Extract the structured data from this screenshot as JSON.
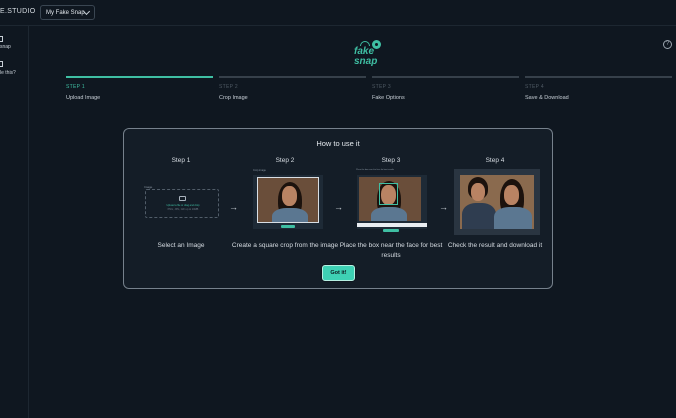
{
  "app": {
    "brand": "E.STUDIO"
  },
  "header": {
    "project_select": "My Fake Snap"
  },
  "sidebar": {
    "items": [
      {
        "label": "snap"
      },
      {
        "label": "le this?"
      }
    ]
  },
  "logo": {
    "top_word": "fake",
    "bottom_word": "snap"
  },
  "stepper": {
    "steps": [
      {
        "num": "STEP 1",
        "label": "Upload Image",
        "active": true
      },
      {
        "num": "STEP 2",
        "label": "Crop Image",
        "active": false
      },
      {
        "num": "STEP 3",
        "label": "Fake Options",
        "active": false
      },
      {
        "num": "STEP 4",
        "label": "Save & Download",
        "active": false
      }
    ]
  },
  "modal": {
    "title": "How to use it",
    "columns": [
      {
        "title": "Step 1",
        "desc": "Select an Image"
      },
      {
        "title": "Step 2",
        "desc": "Create a square crop from the image"
      },
      {
        "title": "Step 3",
        "desc": "Place the box near the face for best results"
      },
      {
        "title": "Step 4",
        "desc": "Check the result and download it"
      }
    ],
    "arrow": "→",
    "upload_label": "Image",
    "upload_text_1": "Upload a file or drag and drop",
    "upload_text_2": "PNG, JPG, GIF up to 10MB",
    "crop_thumb_label": "Crop image",
    "options_thumb_label": "Place the box near the face for best results",
    "button": "Got it!"
  },
  "icons": {
    "help": "help-circle-icon",
    "chevron": "chevron-down-icon",
    "image": "image-icon"
  },
  "colors": {
    "accent": "#3fbfa3",
    "background": "#0f1720",
    "modal_bg": "#141d27"
  }
}
